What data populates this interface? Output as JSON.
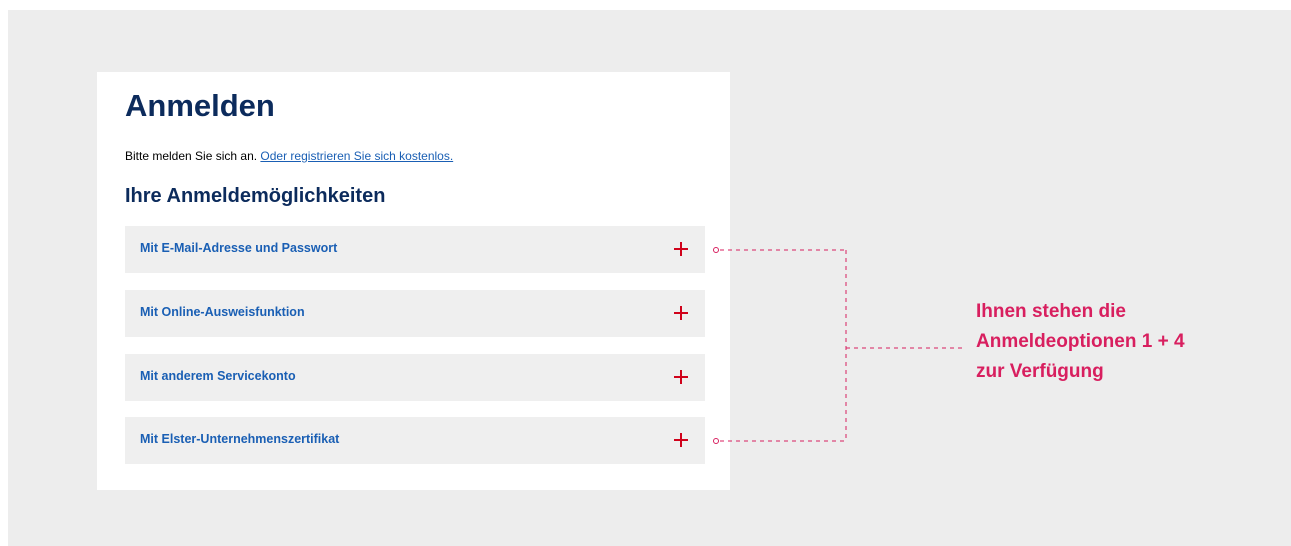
{
  "login": {
    "title": "Anmelden",
    "intro_text": "Bitte melden Sie sich an.",
    "register_link": "Oder registrieren Sie sich kostenlos.",
    "options_heading": "Ihre Anmeldemöglichkeiten",
    "options": [
      {
        "label": "Mit E-Mail-Adresse und Passwort",
        "icon": "plus-icon"
      },
      {
        "label": "Mit Online-Ausweisfunktion",
        "icon": "plus-icon"
      },
      {
        "label": "Mit anderem Servicekonto",
        "icon": "plus-icon"
      },
      {
        "label": "Mit Elster-Unternehmenszertifikat",
        "icon": "plus-icon"
      }
    ]
  },
  "annotation": {
    "text": "Ihnen stehen die\nAnmeldeoptionen 1 + 4\nzur Verfügung"
  },
  "colors": {
    "heading": "#0c2b5c",
    "link": "#1a5fb4",
    "plus_icon": "#d0021b",
    "annotation": "#d81f5f",
    "background": "#ededed"
  }
}
